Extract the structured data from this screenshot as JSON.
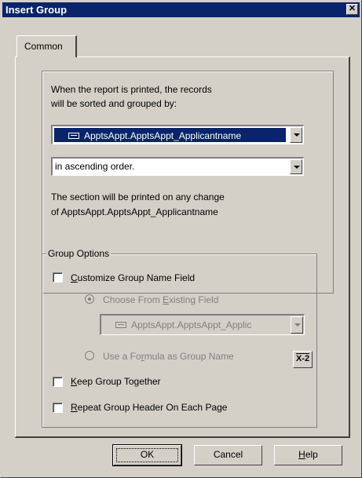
{
  "window": {
    "title": "Insert Group",
    "close_glyph": "✕"
  },
  "tabs": [
    {
      "label": "Common"
    }
  ],
  "sort_section": {
    "description_line1": "When the report is printed, the records",
    "description_line2": "will be sorted and grouped by:",
    "field_value": "ApptsAppt.ApptsAppt_Applicantname",
    "order_value": "in ascending order.",
    "change_line1": "The section will be printed on any change",
    "change_line2": "of  ApptsAppt.ApptsAppt_Applicantname"
  },
  "group_options": {
    "legend": "Group Options",
    "customize_label": "Customize Group Name Field",
    "customize_checked": false,
    "choose_existing_label": "Choose From Existing Field",
    "choose_existing_selected": true,
    "existing_field_value": "ApptsAppt.ApptsAppt_Applic",
    "use_formula_label": "Use a Formula as Group Name",
    "formula_button_label": "X-2",
    "keep_together_label": "Keep Group Together",
    "keep_together_checked": false,
    "repeat_header_label": "Repeat Group Header On Each Page",
    "repeat_header_checked": false
  },
  "buttons": {
    "ok": "OK",
    "cancel": "Cancel",
    "help": "Help"
  },
  "colors": {
    "titlebar": "#0a246a",
    "face": "#d4d0c8",
    "disabled_text": "#808080",
    "selection": "#0a246a"
  }
}
